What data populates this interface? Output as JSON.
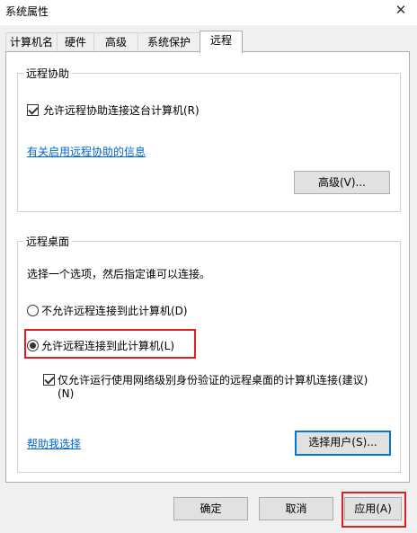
{
  "window": {
    "title": "系统属性",
    "close_glyph": "✕"
  },
  "tabs": [
    {
      "label": "计算机名",
      "active": false
    },
    {
      "label": "硬件",
      "active": false
    },
    {
      "label": "高级",
      "active": false
    },
    {
      "label": "系统保护",
      "active": false
    },
    {
      "label": "远程",
      "active": true
    }
  ],
  "remote_assistance": {
    "title": "远程协助",
    "allow_checkbox_label": "允许远程协助连接这台计算机(R)",
    "allow_checked": true,
    "info_link": "有关启用远程协助的信息",
    "advanced_button": "高级(V)..."
  },
  "remote_desktop": {
    "title": "远程桌面",
    "description": "选择一个选项，然后指定谁可以连接。",
    "option_deny": "不允许远程连接到此计算机(D)",
    "option_allow": "允许远程连接到此计算机(L)",
    "selected_option": "allow",
    "nla_checkbox_line1": "仅允许运行使用网络级别身份验证的远程桌面的计算机连接(建议)",
    "nla_checkbox_line2": "(N)",
    "nla_checked": true,
    "help_link": "帮助我选择",
    "select_users_button": "选择用户(S)..."
  },
  "footer": {
    "ok_button": "确定",
    "cancel_button": "取消",
    "apply_button": "应用(A)"
  },
  "annotation_color": "#e02020",
  "link_color": "#0066cc",
  "focus_color": "#0078d7"
}
